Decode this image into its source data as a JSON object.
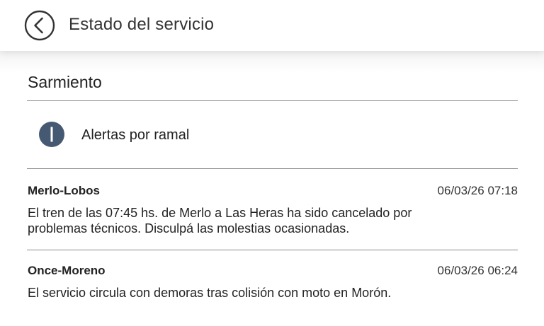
{
  "header": {
    "title": "Estado del servicio",
    "back_icon": "chevron-left-circle-icon"
  },
  "line": {
    "name": "Sarmiento"
  },
  "info": {
    "icon": "info-icon",
    "label": "Alertas por ramal",
    "icon_color": "#455a72"
  },
  "alerts": [
    {
      "route": "Merlo-Lobos",
      "datetime": "06/03/26 07:18",
      "message": "El tren de las 07:45 hs. de Merlo a Las Heras ha sido cancelado por problemas técnicos. Disculpá las molestias ocasionadas."
    },
    {
      "route": "Once-Moreno",
      "datetime": "06/03/26 06:24",
      "message": "El servicio circula con demoras tras colisión con moto en Morón."
    }
  ]
}
